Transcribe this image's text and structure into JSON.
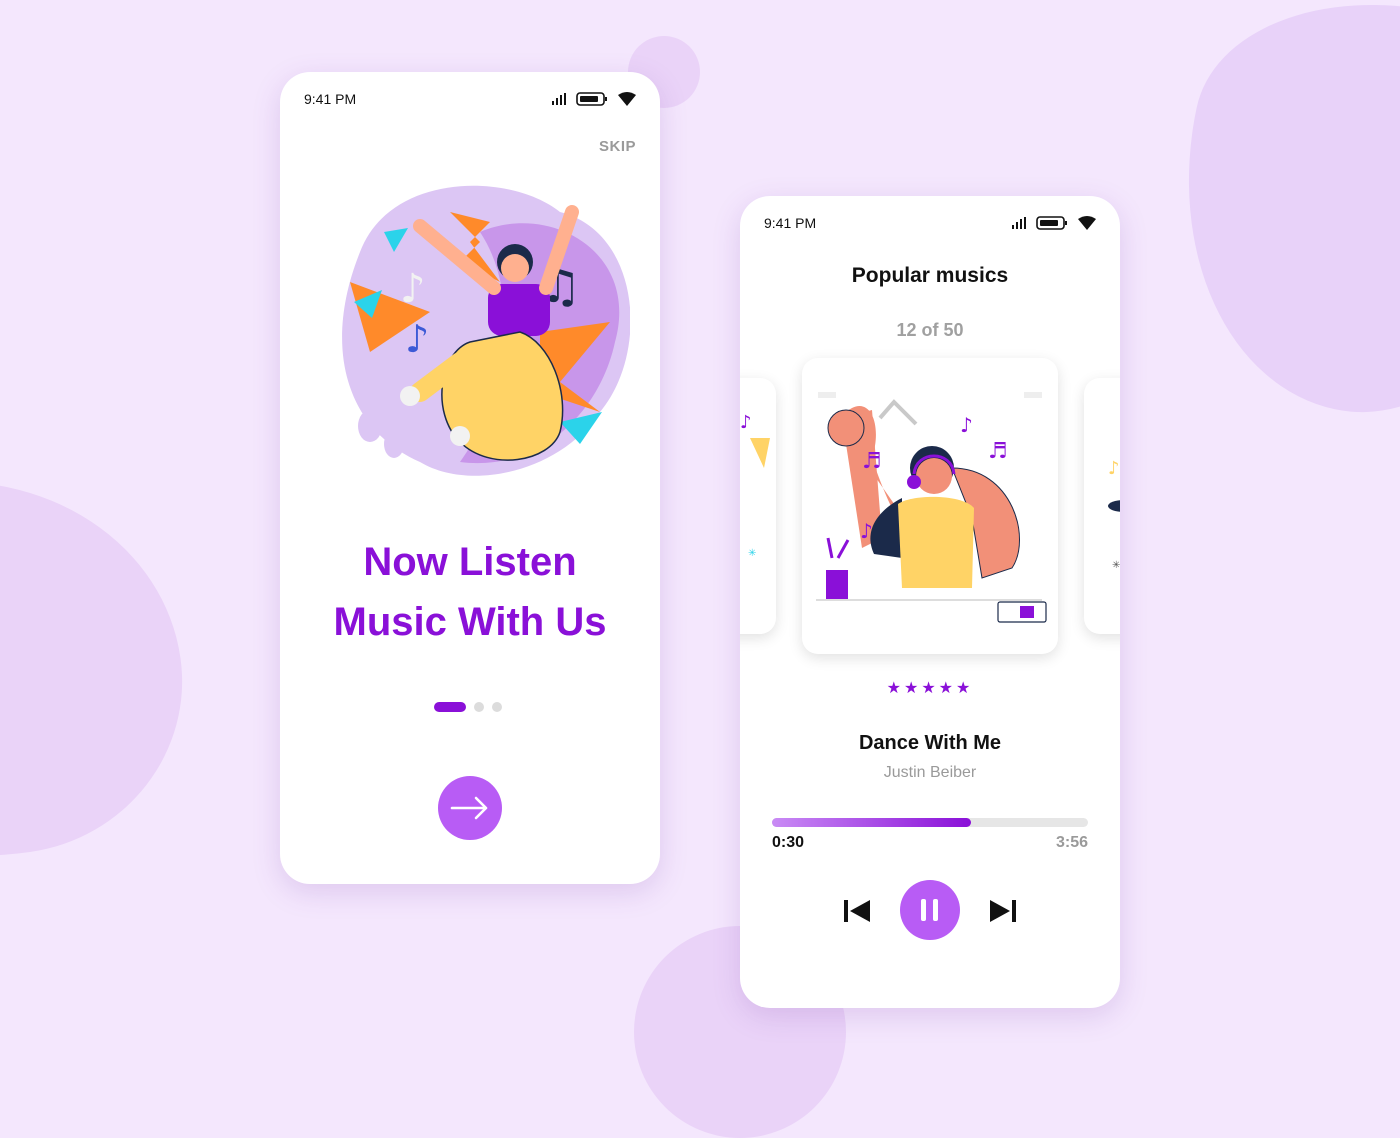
{
  "colors": {
    "background": "#f4e7fd",
    "accent": "#8a10d8",
    "accent_light": "#b85cf5",
    "blob": "#ead3f8"
  },
  "onboarding": {
    "status_time": "9:41 PM",
    "skip_label": "SKIP",
    "headline_line1": "Now Listen",
    "headline_line2": "Music With Us",
    "page_indicator": {
      "total": 3,
      "active": 1
    },
    "next_icon": "arrow-right-icon"
  },
  "player": {
    "status_time": "9:41 PM",
    "title": "Popular musics",
    "position_label": "12 of 50",
    "rating": {
      "value": 5,
      "max": 5,
      "symbol": "★★★★★"
    },
    "song_title": "Dance With Me",
    "artist": "Justin Beiber",
    "elapsed": "0:30",
    "duration": "3:56",
    "progress_fraction": 0.63,
    "controls": [
      "skip-previous-icon",
      "pause-icon",
      "skip-next-icon"
    ]
  }
}
